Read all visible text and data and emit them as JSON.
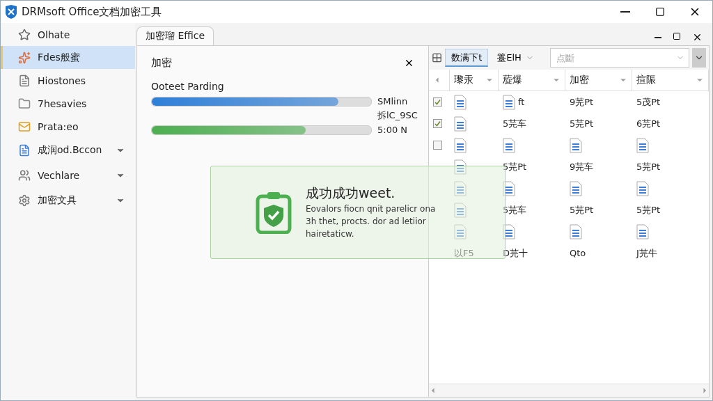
{
  "window": {
    "title": "DRMsoft Office文档加密工具"
  },
  "sidebar": {
    "items": [
      {
        "label": "Olhate",
        "selected": false,
        "expandable": false
      },
      {
        "label": "Fdes般蜜",
        "selected": true,
        "expandable": false
      },
      {
        "label": "Hiostones",
        "selected": false,
        "expandable": false
      },
      {
        "label": "7hesavies",
        "selected": false,
        "expandable": false
      },
      {
        "label": "Prata:eo",
        "selected": false,
        "expandable": false
      },
      {
        "label": "成润od.Bccon",
        "selected": false,
        "expandable": true
      },
      {
        "label": "Vechlare",
        "selected": false,
        "expandable": true
      },
      {
        "label": "加密文具",
        "selected": false,
        "expandable": true
      }
    ]
  },
  "tabs": [
    {
      "label": "加密瑠 Effice",
      "selected": true
    }
  ],
  "progress_panel": {
    "title": "加密",
    "label": "Ooteet Parding",
    "bars": [
      {
        "level": 0.85,
        "color": "#2f7fd8",
        "reading": "SMlinn",
        "note": "拆lC_9SC"
      },
      {
        "level": 0.7,
        "color": "#4caf50",
        "reading": "5:00 N"
      }
    ]
  },
  "toolbar": {
    "buttons": [
      {
        "label": "数满下t",
        "selected": true,
        "dropdown": false
      },
      {
        "label": "籉ElH",
        "selected": false,
        "dropdown": true
      }
    ],
    "combo": {
      "placeholder": "点斷"
    }
  },
  "table": {
    "columns": [
      "瓈汞",
      "蔙爆",
      "加密",
      "揎陙"
    ],
    "rows": [
      {
        "checked": true,
        "cells": [
          {
            "kind": "file"
          },
          {
            "kind": "file_text",
            "text": "ft"
          },
          {
            "kind": "text",
            "text": "9芜Pt"
          },
          {
            "kind": "text",
            "text": "5茂Pt"
          }
        ]
      },
      {
        "checked": true,
        "cells": [
          {
            "kind": "file"
          },
          {
            "kind": "text",
            "text": "5芫车"
          },
          {
            "kind": "text",
            "text": "5芫Pt"
          },
          {
            "kind": "text",
            "text": "6芫Pt"
          }
        ]
      },
      {
        "checked": false,
        "cells": [
          {
            "kind": "file"
          },
          {
            "kind": "file"
          },
          {
            "kind": "file"
          },
          {
            "kind": "file"
          }
        ]
      },
      {
        "cells": [
          {
            "kind": "file"
          },
          {
            "kind": "text",
            "text": "5芫Pt"
          },
          {
            "kind": "text",
            "text": "9芫车"
          },
          {
            "kind": "text",
            "text": "5芫Pt"
          }
        ]
      },
      {
        "cells": [
          {
            "kind": "file"
          },
          {
            "kind": "file"
          },
          {
            "kind": "file"
          },
          {
            "kind": "file"
          }
        ]
      },
      {
        "cells": [
          {
            "kind": "file"
          },
          {
            "kind": "text",
            "text": "5芫车"
          },
          {
            "kind": "text",
            "text": "5芫Pt"
          },
          {
            "kind": "text",
            "text": "5芫Pt"
          }
        ]
      },
      {
        "cells": [
          {
            "kind": "file"
          },
          {
            "kind": "file"
          },
          {
            "kind": "file"
          },
          {
            "kind": "file"
          }
        ]
      },
      {
        "cells": [
          {
            "kind": "text",
            "text": "以F5"
          },
          {
            "kind": "text",
            "text": "D芫十"
          },
          {
            "kind": "text",
            "text": "Qto"
          },
          {
            "kind": "text",
            "text": "J芫牛"
          }
        ]
      }
    ]
  },
  "toast": {
    "title": "成功成功weet.",
    "message": "Eovalors fiocn qnit parelicr ona 3h thet, procts. dor ad letiior hairetaticw."
  }
}
